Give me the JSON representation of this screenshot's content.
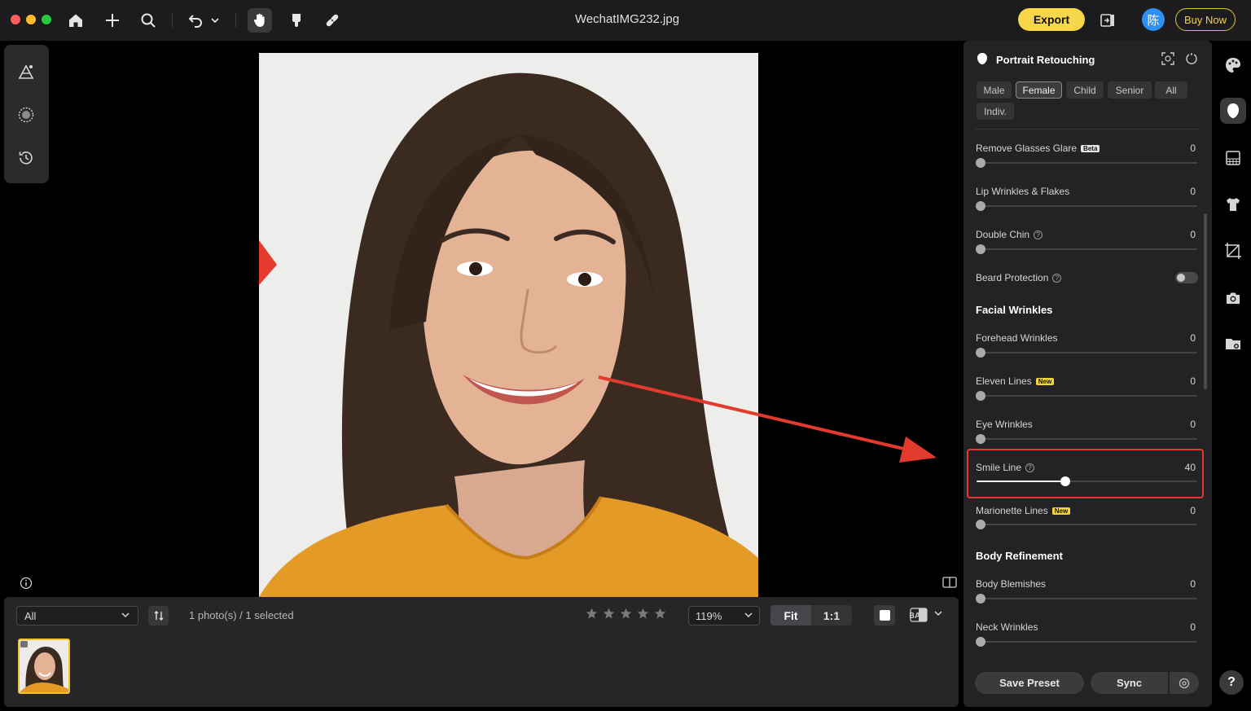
{
  "window": {
    "title": "WechatIMG232.jpg"
  },
  "header": {
    "export_label": "Export",
    "buy_now_label": "Buy Now",
    "avatar_text": "陈"
  },
  "colors": {
    "accent_yellow": "#f7d64a",
    "highlight_red": "#e23a2c",
    "avatar_blue": "#2f8ff3"
  },
  "bottom": {
    "filter_value": "All",
    "photo_count": "1 photo(s) / 1 selected",
    "rating": 0,
    "zoom_value": "119%",
    "fit_label": "Fit",
    "one_to_one_label": "1:1",
    "ba_label": "BA"
  },
  "panel": {
    "title": "Portrait Retouching",
    "chips": [
      "Male",
      "Female",
      "Child",
      "Senior",
      "All",
      "Indiv."
    ],
    "selected_chip": "Female",
    "sliders": {
      "remove_glasses_glare": {
        "label": "Remove Glasses Glare",
        "badge": "Beta",
        "value": "0"
      },
      "lip_wrinkles": {
        "label": "Lip Wrinkles & Flakes",
        "value": "0"
      },
      "double_chin": {
        "label": "Double Chin",
        "value": "0"
      },
      "forehead_wrinkles": {
        "label": "Forehead Wrinkles",
        "value": "0"
      },
      "eleven_lines": {
        "label": "Eleven Lines",
        "badge": "New",
        "value": "0"
      },
      "eye_wrinkles": {
        "label": "Eye Wrinkles",
        "value": "0"
      },
      "smile_line": {
        "label": "Smile Line",
        "value": "40"
      },
      "marionette_lines": {
        "label": "Marionette Lines",
        "badge": "New",
        "value": "0"
      },
      "body_blemishes": {
        "label": "Body Blemishes",
        "value": "0"
      },
      "neck_wrinkles": {
        "label": "Neck Wrinkles",
        "value": "0"
      }
    },
    "beard_protection": {
      "label": "Beard Protection",
      "enabled": false
    },
    "sections": {
      "facial_wrinkles": "Facial Wrinkles",
      "body_refinement": "Body Refinement"
    },
    "save_preset_label": "Save Preset",
    "sync_label": "Sync"
  },
  "rail": {
    "items": [
      "palette-icon",
      "portrait-icon",
      "background-icon",
      "clothing-icon",
      "crop-icon",
      "camera-icon",
      "folder-icon"
    ],
    "active": "portrait-icon",
    "help_label": "?"
  }
}
